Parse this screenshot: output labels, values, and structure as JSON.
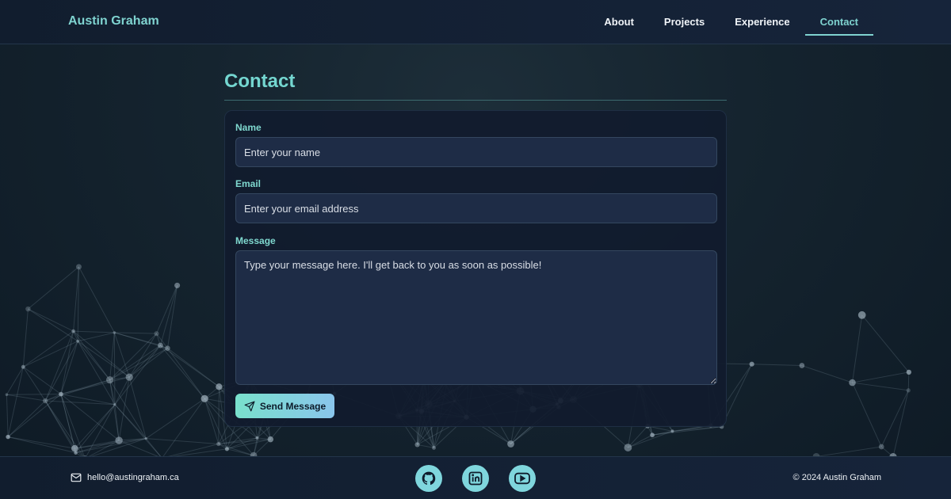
{
  "header": {
    "brand": "Austin Graham",
    "nav": [
      {
        "label": "About"
      },
      {
        "label": "Projects"
      },
      {
        "label": "Experience"
      },
      {
        "label": "Contact",
        "active": true
      }
    ]
  },
  "main": {
    "title": "Contact",
    "form": {
      "name": {
        "label": "Name",
        "placeholder": "Enter your name",
        "value": ""
      },
      "email": {
        "label": "Email",
        "placeholder": "Enter your email address",
        "value": ""
      },
      "message": {
        "label": "Message",
        "placeholder": "Type your message here. I'll get back to you as soon as possible!",
        "value": ""
      },
      "submit_label": "Send Message",
      "submit_icon": "send-icon"
    }
  },
  "footer": {
    "email": "hello@austingraham.ca",
    "email_icon": "mail-icon",
    "socials": [
      {
        "icon": "github-icon"
      },
      {
        "icon": "linkedin-icon"
      },
      {
        "icon": "youtube-icon"
      }
    ],
    "copyright": "© 2024 Austin Graham"
  },
  "colors": {
    "accent": "#7fd3d0",
    "header_bg": "#111d2e",
    "card_bg": "#111b2e",
    "input_bg": "#1e2c46"
  }
}
